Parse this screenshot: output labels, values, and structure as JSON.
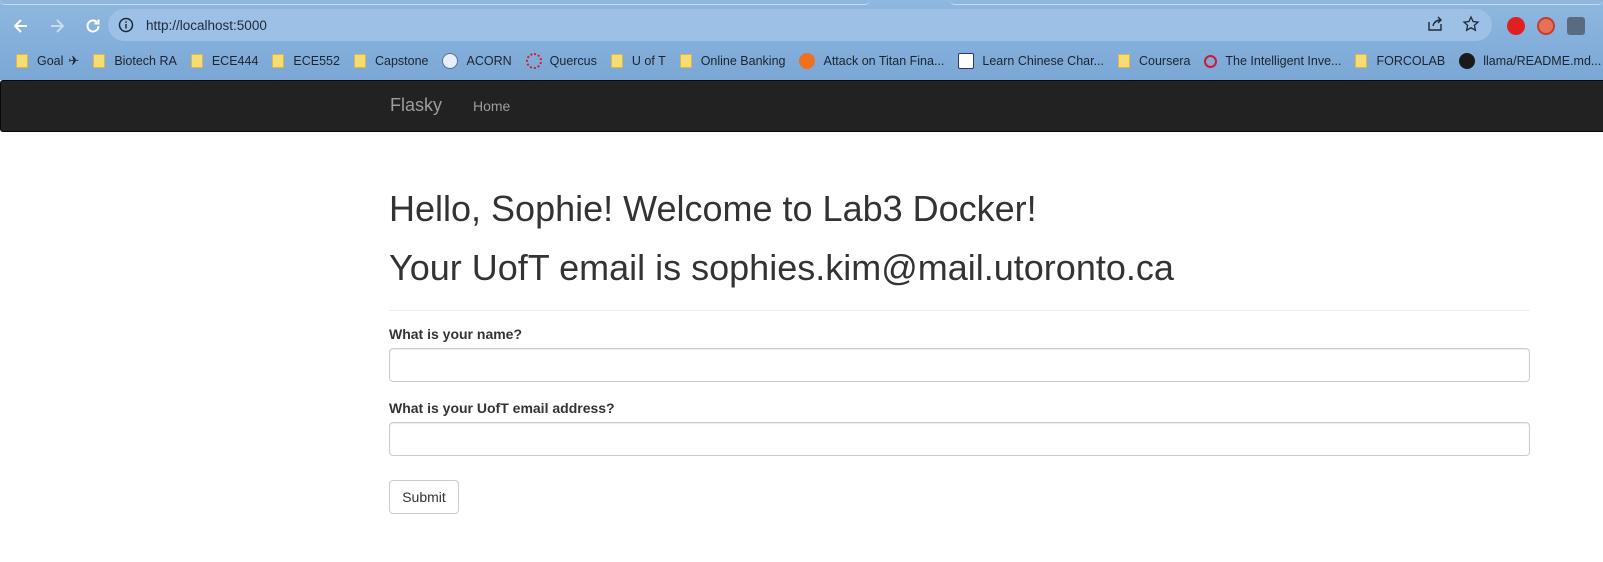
{
  "browser": {
    "url": "http://localhost:5000",
    "bookmarks": [
      {
        "label": "Goal",
        "icon": "folder-icon"
      },
      {
        "label": "Biotech RA",
        "icon": "folder-icon"
      },
      {
        "label": "ECE444",
        "icon": "folder-icon"
      },
      {
        "label": "ECE552",
        "icon": "folder-icon"
      },
      {
        "label": "Capstone",
        "icon": "folder-icon"
      },
      {
        "label": "ACORN",
        "icon": "acorn-icon"
      },
      {
        "label": "Quercus",
        "icon": "quercus-icon"
      },
      {
        "label": "U of T",
        "icon": "folder-icon"
      },
      {
        "label": "Online Banking",
        "icon": "folder-icon"
      },
      {
        "label": "Attack on Titan Fina...",
        "icon": "site-icon"
      },
      {
        "label": "Learn Chinese Char...",
        "icon": "site-icon"
      },
      {
        "label": "Coursera",
        "icon": "folder-icon"
      },
      {
        "label": "The Intelligent Inve...",
        "icon": "site-icon"
      },
      {
        "label": "FORCOLAB",
        "icon": "folder-icon"
      },
      {
        "label": "llama/README.md...",
        "icon": "github-icon"
      }
    ]
  },
  "navbar": {
    "brand": "Flasky",
    "home": "Home"
  },
  "main": {
    "greeting": "Hello, Sophie! Welcome to Lab3 Docker!",
    "email_line": "Your UofT email is sophies.kim@mail.utoronto.ca",
    "name_label": "What is your name?",
    "name_value": "",
    "email_label": "What is your UofT email address?",
    "email_value": "",
    "submit": "Submit"
  },
  "colors": {
    "navbar_bg": "#222222",
    "navbar_text": "#9d9d9d",
    "chrome_bg": "#8fb8e0"
  }
}
